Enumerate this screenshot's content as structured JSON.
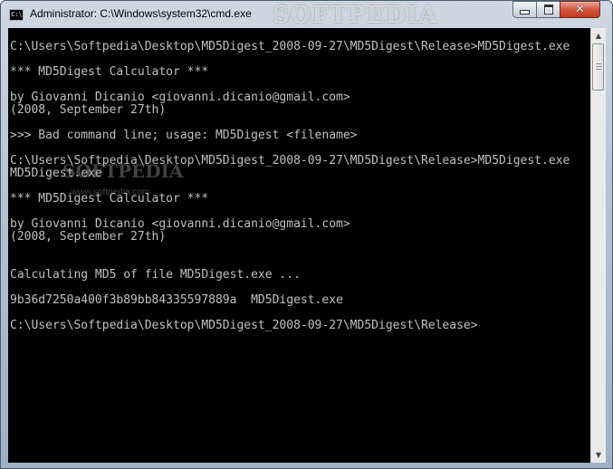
{
  "window": {
    "title": "Administrator: C:\\Windows\\system32\\cmd.exe",
    "watermark": "SOFTPEDIA",
    "icon_label": "C:\\",
    "controls": {
      "minimize": "minimize-icon",
      "maximize": "maximize-icon",
      "close": "close-icon"
    }
  },
  "console": {
    "background": "#000000",
    "text_color": "#c0c0c0",
    "lines": [
      "C:\\Users\\Softpedia\\Desktop\\MD5Digest_2008-09-27\\MD5Digest\\Release>MD5Digest.exe",
      "",
      "*** MD5Digest Calculator ***",
      "",
      "by Giovanni Dicanio <giovanni.dicanio@gmail.com>",
      "(2008, September 27th)",
      "",
      ">>> Bad command line; usage: MD5Digest <filename>",
      "",
      "C:\\Users\\Softpedia\\Desktop\\MD5Digest_2008-09-27\\MD5Digest\\Release>MD5Digest.exe",
      "MD5Digest.exe",
      "",
      "*** MD5Digest Calculator ***",
      "",
      "by Giovanni Dicanio <giovanni.dicanio@gmail.com>",
      "(2008, September 27th)",
      "",
      "",
      "Calculating MD5 of file MD5Digest.exe ...",
      "",
      "9b36d7250a400f3b89bb84335597889a  MD5Digest.exe",
      "",
      "C:\\Users\\Softpedia\\Desktop\\MD5Digest_2008-09-27\\MD5Digest\\Release>"
    ],
    "overlay_watermark": "SOFTPEDIA",
    "overlay_url": "www.softpedia.com"
  },
  "scrollbar": {
    "up": "▲",
    "down": "▼"
  }
}
